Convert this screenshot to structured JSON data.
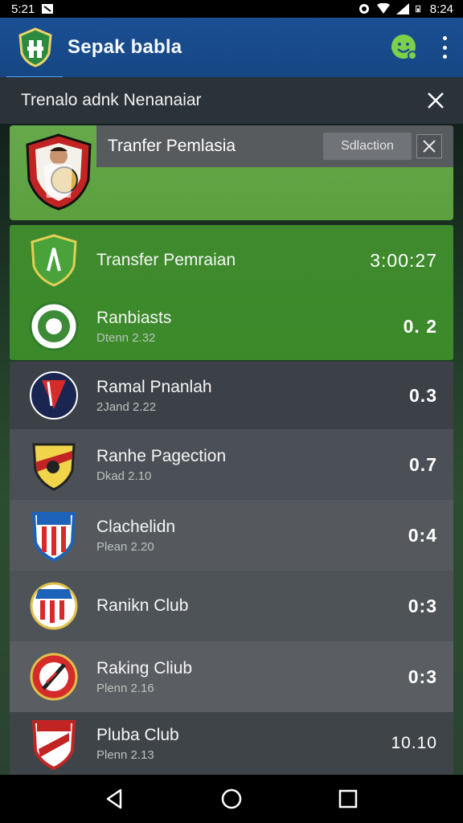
{
  "status_bar": {
    "time_left": "5:21",
    "time_right": "8:24"
  },
  "app": {
    "title": "Sepak babla"
  },
  "panel": {
    "title": "Trenalo adnk Nenanaiar"
  },
  "featured": {
    "title": "Tranfer Pemlasia",
    "pill_label": "Sdlaction"
  },
  "rows": [
    {
      "name": "Transfer Pemraian",
      "sub": "",
      "score": "3:00:27"
    },
    {
      "name": "Ranbiasts",
      "sub": "Dtenn 2.32",
      "score": "0. 2"
    },
    {
      "name": "Ramal Pnanlah",
      "sub": "2Jand 2.22",
      "score": "0.3"
    },
    {
      "name": "Ranhe Pagection",
      "sub": "Dkad 2.10",
      "score": "0.7"
    },
    {
      "name": "Clachelidn",
      "sub": "Plean 2.20",
      "score": "0:4"
    },
    {
      "name": "Ranikn Club",
      "sub": "",
      "score": "0:3"
    },
    {
      "name": "Raking Cliub",
      "sub": "Plenn 2.16",
      "score": "0:3"
    },
    {
      "name": "Pluba Club",
      "sub": "Plenn 2.13",
      "score": "10.10"
    }
  ],
  "colors": {
    "appbar": "#1a4f94",
    "featured_green": "#66a94a",
    "block_green": "#3f8a2d",
    "action_icon": "#7bd24a"
  },
  "icons": {
    "app_logo": "shield-logo-icon",
    "action": "smiley-icon",
    "menu": "more-vert-icon",
    "close": "close-icon",
    "nav_back": "back-icon",
    "nav_home": "home-icon",
    "nav_recent": "recent-apps-icon"
  }
}
